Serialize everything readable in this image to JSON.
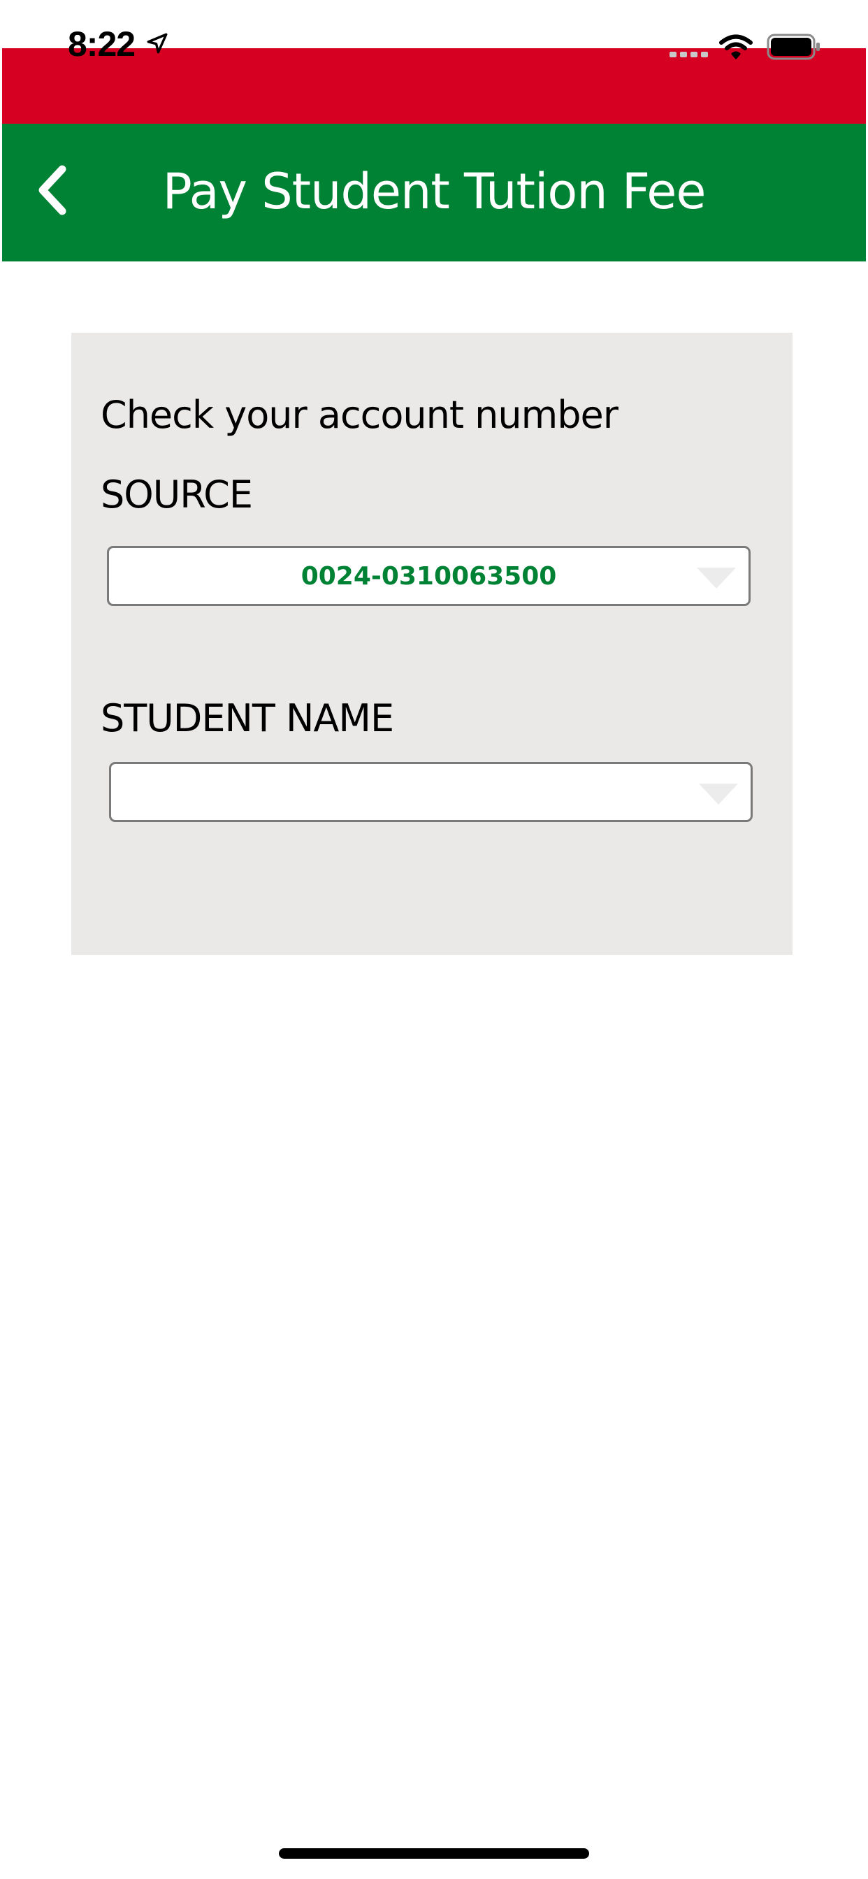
{
  "status_bar": {
    "time": "8:22",
    "icons": [
      "location-arrow-icon",
      "cellular-signal-icon",
      "wifi-icon",
      "battery-icon"
    ]
  },
  "colors": {
    "red_band": "#d50022",
    "header_green": "#008235",
    "card_background": "#ebe8e8",
    "select_value_text": "#008235"
  },
  "header": {
    "title": "Pay Student Tution Fee",
    "back_icon": "chevron-left-icon"
  },
  "form": {
    "heading": "Check your account number",
    "source": {
      "label": "SOURCE",
      "selected_value": "0024-0310063500"
    },
    "student_name": {
      "label": "STUDENT NAME",
      "selected_value": ""
    }
  }
}
